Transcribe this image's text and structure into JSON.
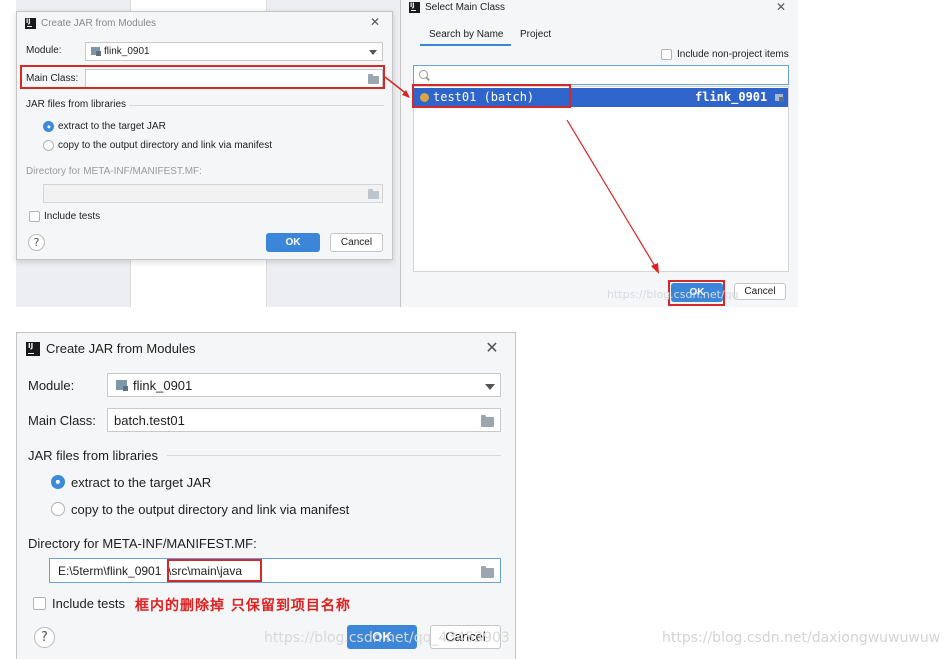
{
  "top_left_dialog": {
    "title": "Create JAR from Modules",
    "module_label": "Module:",
    "module_value": "flink_0901",
    "main_class_label": "Main Class:",
    "main_class_value": "",
    "jar_section_label": "JAR files from libraries",
    "radio_extract": "extract to the target JAR",
    "radio_copy": "copy to the output directory and link via manifest",
    "manifest_dir_label": "Directory for META-INF/MANIFEST.MF:",
    "manifest_dir_value": "",
    "include_tests": "Include tests",
    "ok": "OK",
    "cancel": "Cancel",
    "help": "?"
  },
  "select_main_class": {
    "title": "Select Main Class",
    "tab_name": "Search by Name",
    "tab_project": "Project",
    "include_non_project": "Include non-project items",
    "search_value": "",
    "result_class": "test01 (batch)",
    "result_module": "flink_0901",
    "ok": "OK",
    "cancel": "Cancel"
  },
  "bottom_dialog": {
    "title": "Create JAR from Modules",
    "module_label": "Module:",
    "module_value": "flink_0901",
    "main_class_label": "Main Class:",
    "main_class_value": "batch.test01",
    "jar_section_label": "JAR files from libraries",
    "radio_extract": "extract to the target JAR",
    "radio_copy": "copy to the output directory and link via manifest",
    "manifest_dir_label": "Directory for META-INF/MANIFEST.MF:",
    "manifest_dir_prefix": "E:\\5term\\flink_0901",
    "manifest_dir_highlight": "\\src\\main\\java",
    "include_tests": "Include tests",
    "annotation": "框内的删除掉 只保留到项目名称",
    "ok": "OK",
    "cancel": "Cancel",
    "help": "?"
  },
  "watermarks": {
    "top_right": "https://blog.csdn.net/qq",
    "bottom_middle": "https://blog.csdn.net/qq_43453903",
    "bottom_right": "https://blog.csdn.net/daxiongwuwuwuw"
  },
  "colors": {
    "accent": "#3c86d9",
    "selection": "#2f65ca",
    "highlight_red": "#d62828",
    "annotation_red": "#e02020"
  },
  "icons": [
    "intellij-logo-icon",
    "close-icon",
    "module-icon",
    "dropdown-caret-icon",
    "folder-icon",
    "search-icon",
    "class-icon",
    "help-icon"
  ]
}
